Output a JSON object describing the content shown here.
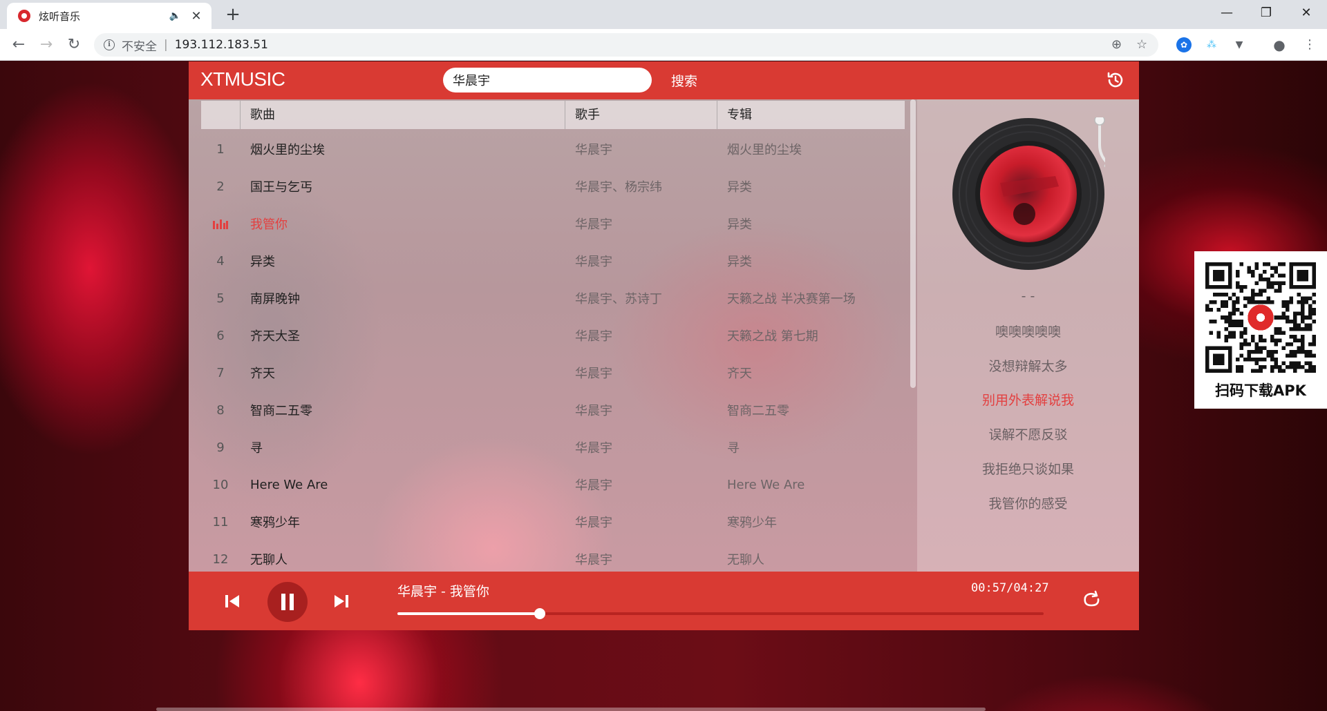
{
  "browser": {
    "tab_title": "炫听音乐",
    "new_tab": "+",
    "insecure_label": "不安全",
    "separator": "|",
    "url": "193.112.183.51"
  },
  "app": {
    "logo": "XTMUSIC",
    "search_value": "华晨宇",
    "search_button": "搜索",
    "columns": {
      "num": "",
      "song": "歌曲",
      "singer": "歌手",
      "album": "专辑"
    },
    "songs": [
      {
        "num": "1",
        "song": "烟火里的尘埃",
        "singer": "华晨宇",
        "album": "烟火里的尘埃"
      },
      {
        "num": "2",
        "song": "国王与乞丐",
        "singer": "华晨宇、杨宗纬",
        "album": "异类"
      },
      {
        "num": "",
        "song": "我管你",
        "singer": "华晨宇",
        "album": "异类",
        "playing": true
      },
      {
        "num": "4",
        "song": "异类",
        "singer": "华晨宇",
        "album": "异类"
      },
      {
        "num": "5",
        "song": "南屏晚钟",
        "singer": "华晨宇、苏诗丁",
        "album": "天籁之战 半决赛第一场"
      },
      {
        "num": "6",
        "song": "齐天大圣",
        "singer": "华晨宇",
        "album": "天籁之战 第七期"
      },
      {
        "num": "7",
        "song": "齐天",
        "singer": "华晨宇",
        "album": "齐天"
      },
      {
        "num": "8",
        "song": "智商二五零",
        "singer": "华晨宇",
        "album": "智商二五零"
      },
      {
        "num": "9",
        "song": "寻",
        "singer": "华晨宇",
        "album": "寻"
      },
      {
        "num": "10",
        "song": "Here We Are",
        "singer": "华晨宇",
        "album": "Here We Are"
      },
      {
        "num": "11",
        "song": "寒鸦少年",
        "singer": "华晨宇",
        "album": "寒鸦少年"
      },
      {
        "num": "12",
        "song": "无聊人",
        "singer": "华晨宇",
        "album": "无聊人"
      }
    ],
    "lyrics": {
      "lines": [
        "- -",
        "噢噢噢噢噢",
        "没想辩解太多",
        "别用外表解说我",
        "误解不愿反驳",
        "我拒绝只谈如果",
        "我管你的感受"
      ],
      "current_index": 3
    },
    "player": {
      "now_playing": "华晨宇 - 我管你",
      "time": "00:57/04:27",
      "progress": 0.22
    }
  },
  "promo": {
    "qr_label": "扫码下载APK"
  },
  "colors": {
    "brand_red": "#d93a33",
    "highlight_red": "#e34040"
  }
}
